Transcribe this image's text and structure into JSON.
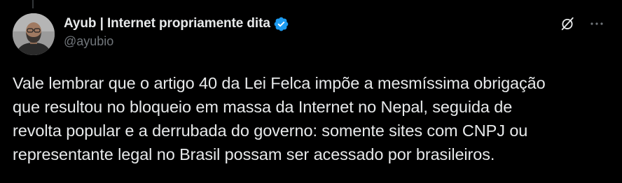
{
  "author": {
    "display_name": "Ayub | Internet propriamente dita",
    "handle": "@ayubio",
    "verified": true
  },
  "tweet": {
    "text": "Vale lembrar que o artigo 40 da Lei Felca impõe a mesmíssima obrigação\nque resultou no bloqueio em massa da Internet no Nepal, seguida de\nrevolta popular e a derrubada do governo: somente sites com CNPJ ou\nrepresentante legal no Brasil possam ser acessado por brasileiros."
  },
  "actions": {
    "grok_icon": "grok-icon",
    "more_icon": "more-icon"
  },
  "colors": {
    "background": "#000000",
    "text_primary": "#e7e9ea",
    "text_secondary": "#71767b",
    "verified_badge": "#1d9bf0"
  }
}
